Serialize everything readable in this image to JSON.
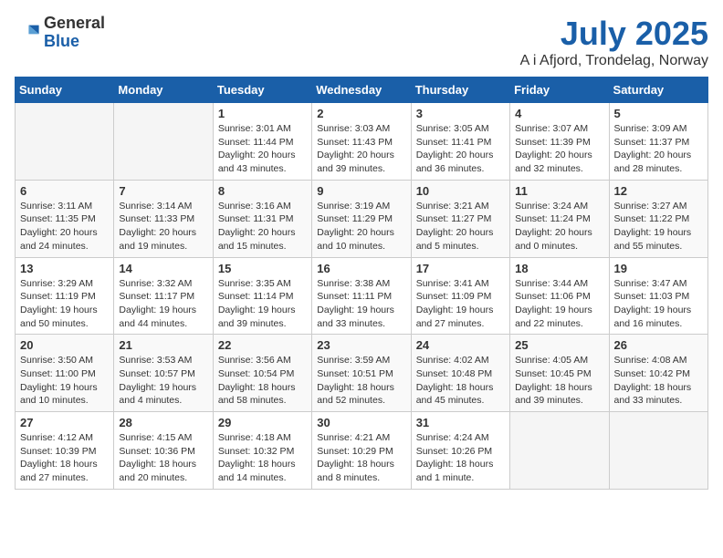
{
  "header": {
    "logo_general": "General",
    "logo_blue": "Blue",
    "month_title": "July 2025",
    "location": "A i Afjord, Trondelag, Norway"
  },
  "days_of_week": [
    "Sunday",
    "Monday",
    "Tuesday",
    "Wednesday",
    "Thursday",
    "Friday",
    "Saturday"
  ],
  "weeks": [
    [
      {
        "day": "",
        "info": ""
      },
      {
        "day": "",
        "info": ""
      },
      {
        "day": "1",
        "info": "Sunrise: 3:01 AM\nSunset: 11:44 PM\nDaylight: 20 hours\nand 43 minutes."
      },
      {
        "day": "2",
        "info": "Sunrise: 3:03 AM\nSunset: 11:43 PM\nDaylight: 20 hours\nand 39 minutes."
      },
      {
        "day": "3",
        "info": "Sunrise: 3:05 AM\nSunset: 11:41 PM\nDaylight: 20 hours\nand 36 minutes."
      },
      {
        "day": "4",
        "info": "Sunrise: 3:07 AM\nSunset: 11:39 PM\nDaylight: 20 hours\nand 32 minutes."
      },
      {
        "day": "5",
        "info": "Sunrise: 3:09 AM\nSunset: 11:37 PM\nDaylight: 20 hours\nand 28 minutes."
      }
    ],
    [
      {
        "day": "6",
        "info": "Sunrise: 3:11 AM\nSunset: 11:35 PM\nDaylight: 20 hours\nand 24 minutes."
      },
      {
        "day": "7",
        "info": "Sunrise: 3:14 AM\nSunset: 11:33 PM\nDaylight: 20 hours\nand 19 minutes."
      },
      {
        "day": "8",
        "info": "Sunrise: 3:16 AM\nSunset: 11:31 PM\nDaylight: 20 hours\nand 15 minutes."
      },
      {
        "day": "9",
        "info": "Sunrise: 3:19 AM\nSunset: 11:29 PM\nDaylight: 20 hours\nand 10 minutes."
      },
      {
        "day": "10",
        "info": "Sunrise: 3:21 AM\nSunset: 11:27 PM\nDaylight: 20 hours\nand 5 minutes."
      },
      {
        "day": "11",
        "info": "Sunrise: 3:24 AM\nSunset: 11:24 PM\nDaylight: 20 hours\nand 0 minutes."
      },
      {
        "day": "12",
        "info": "Sunrise: 3:27 AM\nSunset: 11:22 PM\nDaylight: 19 hours\nand 55 minutes."
      }
    ],
    [
      {
        "day": "13",
        "info": "Sunrise: 3:29 AM\nSunset: 11:19 PM\nDaylight: 19 hours\nand 50 minutes."
      },
      {
        "day": "14",
        "info": "Sunrise: 3:32 AM\nSunset: 11:17 PM\nDaylight: 19 hours\nand 44 minutes."
      },
      {
        "day": "15",
        "info": "Sunrise: 3:35 AM\nSunset: 11:14 PM\nDaylight: 19 hours\nand 39 minutes."
      },
      {
        "day": "16",
        "info": "Sunrise: 3:38 AM\nSunset: 11:11 PM\nDaylight: 19 hours\nand 33 minutes."
      },
      {
        "day": "17",
        "info": "Sunrise: 3:41 AM\nSunset: 11:09 PM\nDaylight: 19 hours\nand 27 minutes."
      },
      {
        "day": "18",
        "info": "Sunrise: 3:44 AM\nSunset: 11:06 PM\nDaylight: 19 hours\nand 22 minutes."
      },
      {
        "day": "19",
        "info": "Sunrise: 3:47 AM\nSunset: 11:03 PM\nDaylight: 19 hours\nand 16 minutes."
      }
    ],
    [
      {
        "day": "20",
        "info": "Sunrise: 3:50 AM\nSunset: 11:00 PM\nDaylight: 19 hours\nand 10 minutes."
      },
      {
        "day": "21",
        "info": "Sunrise: 3:53 AM\nSunset: 10:57 PM\nDaylight: 19 hours\nand 4 minutes."
      },
      {
        "day": "22",
        "info": "Sunrise: 3:56 AM\nSunset: 10:54 PM\nDaylight: 18 hours\nand 58 minutes."
      },
      {
        "day": "23",
        "info": "Sunrise: 3:59 AM\nSunset: 10:51 PM\nDaylight: 18 hours\nand 52 minutes."
      },
      {
        "day": "24",
        "info": "Sunrise: 4:02 AM\nSunset: 10:48 PM\nDaylight: 18 hours\nand 45 minutes."
      },
      {
        "day": "25",
        "info": "Sunrise: 4:05 AM\nSunset: 10:45 PM\nDaylight: 18 hours\nand 39 minutes."
      },
      {
        "day": "26",
        "info": "Sunrise: 4:08 AM\nSunset: 10:42 PM\nDaylight: 18 hours\nand 33 minutes."
      }
    ],
    [
      {
        "day": "27",
        "info": "Sunrise: 4:12 AM\nSunset: 10:39 PM\nDaylight: 18 hours\nand 27 minutes."
      },
      {
        "day": "28",
        "info": "Sunrise: 4:15 AM\nSunset: 10:36 PM\nDaylight: 18 hours\nand 20 minutes."
      },
      {
        "day": "29",
        "info": "Sunrise: 4:18 AM\nSunset: 10:32 PM\nDaylight: 18 hours\nand 14 minutes."
      },
      {
        "day": "30",
        "info": "Sunrise: 4:21 AM\nSunset: 10:29 PM\nDaylight: 18 hours\nand 8 minutes."
      },
      {
        "day": "31",
        "info": "Sunrise: 4:24 AM\nSunset: 10:26 PM\nDaylight: 18 hours\nand 1 minute."
      },
      {
        "day": "",
        "info": ""
      },
      {
        "day": "",
        "info": ""
      }
    ]
  ]
}
